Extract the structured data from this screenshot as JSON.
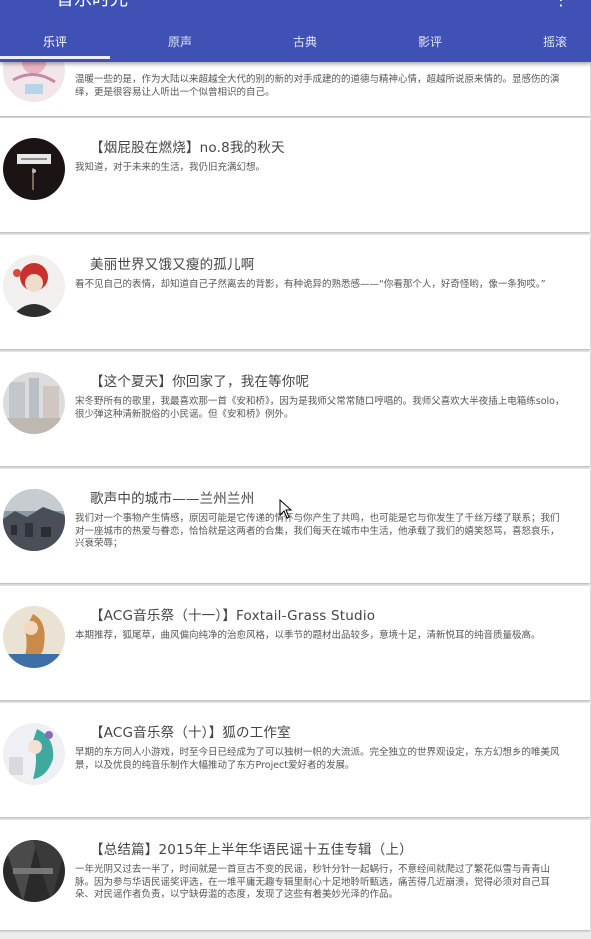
{
  "app": {
    "title": "音乐时光",
    "tabs": [
      {
        "label": "乐评",
        "active": true
      },
      {
        "label": "原声",
        "active": false
      },
      {
        "label": "古典",
        "active": false
      },
      {
        "label": "影评",
        "active": false
      },
      {
        "label": "摇滚",
        "active": false
      }
    ],
    "accent_color": "#3f51b5"
  },
  "cards": [
    {
      "title": "",
      "desc": "温暖一些的是，作为大陆以来超越全大代的别的新的对手成建的的道德与精神心情，超越所说原来情的。显感伤的演绎，更是很容易让人听出一个似曾相识的自己。"
    },
    {
      "title": "【烟屁股在燃烧】no.8我的秋天",
      "desc": "我知道，对于未来的生活，我仍旧充满幻想。"
    },
    {
      "title": "美丽世界又饿又瘦的孤儿啊",
      "desc": "看不见自己的表情，却知道自己子然离去的背影，有种诡异的熟悉感——“你看那个人，好奇怪哟，像一条狗哎。”"
    },
    {
      "title": "【这个夏天】你回家了，我在等你呢",
      "desc": "宋冬野所有的歌里，我最喜欢那一首《安和桥》，因为是我师父常常随口哼唱的。我师父喜欢大半夜插上电箱练solo，很少弹这种清新脱俗的小民谣。但《安和桥》例外。"
    },
    {
      "title": "歌声中的城市——兰州兰州",
      "desc": "我们对一个事物产生情感，原因可能是它传递的情怀与你产生了共鸣，也可能是它与你发生了千丝万缕了联系；我们对一座城市的热爱与眷恋，恰恰就是这两者的合集，我们每天在城市中生活，他承载了我们的嬉笑怒骂，喜怒哀乐，兴衰荣辱；"
    },
    {
      "title": "【ACG音乐祭（十一）】Foxtail-Grass Studio",
      "desc": "本期推荐，狐尾草，曲风偏向纯净的治愈风格，以季节的题材出品较多，意境十足，清新悦耳的纯音质量极高。"
    },
    {
      "title": "【ACG音乐祭（十）】狐の工作室",
      "desc": "早期的东方同人小游戏，时至今日已经成为了可以独树一帜的大流派。完全独立的世界观设定，东方幻想乡的唯美风景，以及优良的纯音乐制作大幅推动了东方Project爱好者的发展。"
    },
    {
      "title": "【总结篇】2015年上半年华语民谣十五佳专辑（上）",
      "desc": "一年光阴又过去一半了，时间就是一首亘古不变的民谣，秒针分针一起蜗行，不意经间就爬过了繁花似雪与青青山脉。因为参与华语民谣奖评选，在一堆平庸无趣专辑里耐心十足地聆听甄选，痛苦得几近崩溃，觉得必须对自己耳朵、对民谣作者负责，以宁缺毋滥的态度，发现了这些有着美妙光泽的作品。"
    }
  ]
}
